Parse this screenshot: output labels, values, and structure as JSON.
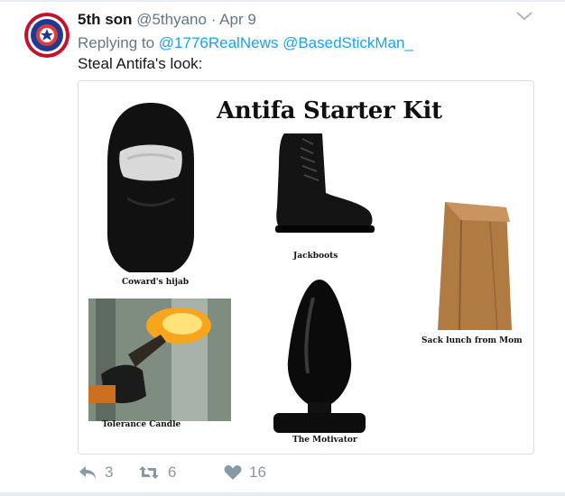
{
  "tweet": {
    "author_name": "5th son",
    "handle": "@5thyano",
    "separator": "·",
    "date": "Apr 9",
    "replying_prefix": "Replying to",
    "mentions": [
      "@1776RealNews",
      "@BasedStickMan_"
    ],
    "text": "Steal Antifa's look:"
  },
  "media": {
    "title": "Antifa Starter Kit",
    "captions": {
      "balaclava": "Coward's hijab",
      "boot": "Jackboots",
      "bag": "Sack lunch from Mom",
      "molotov": "Tolerance Candle",
      "plug": "The Motivator"
    }
  },
  "actions": {
    "reply_count": "3",
    "retweet_count": "6",
    "like_count": "16"
  },
  "colors": {
    "name_text": "#14171a",
    "muted_text": "#657786",
    "mention_link": "#1da1f2",
    "action_icons": "#8899a6",
    "divider": "#e6ecf0"
  },
  "icons": [
    "avatar-badge-icon",
    "chevron-down-icon",
    "reply-icon",
    "retweet-icon",
    "heart-icon"
  ]
}
